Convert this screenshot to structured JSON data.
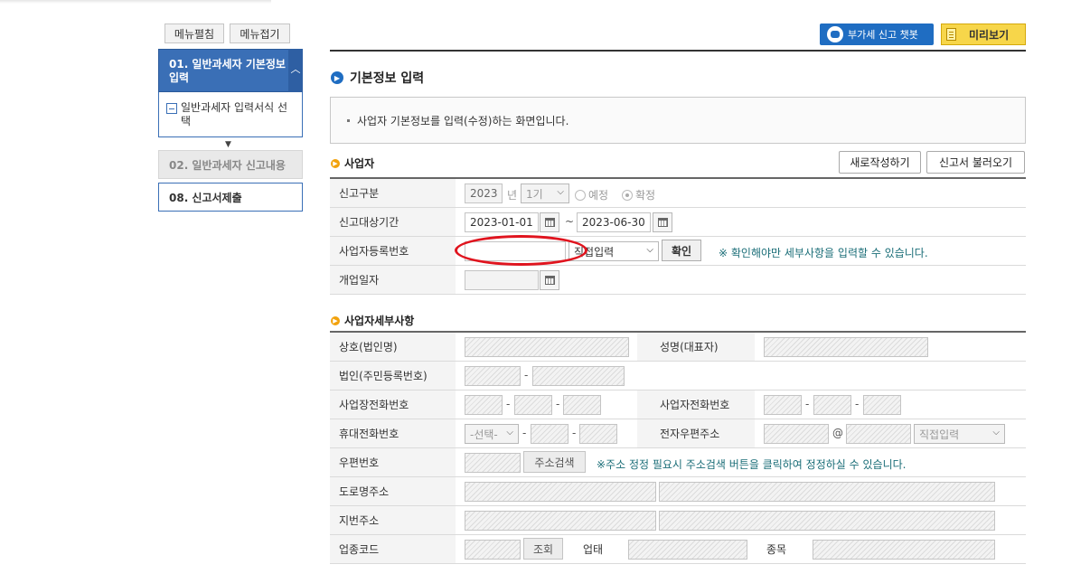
{
  "sidebar": {
    "expand_label": "메뉴펼침",
    "collapse_label": "메뉴접기",
    "active_item": "01. 일반과세자 기본정보 입력",
    "sub_item": "일반과세자 입력서식 선택",
    "item2": "02. 일반과세자 신고내용",
    "item3": "08. 신고서제출"
  },
  "top": {
    "chatbot_label": "부가세 신고 챗봇",
    "preview_label": "미리보기"
  },
  "page": {
    "title": "기본정보 입력",
    "info": "사업자 기본정보를 입력(수정)하는 화면입니다."
  },
  "business": {
    "section_title": "사업자",
    "new_button": "새로작성하기",
    "load_button": "신고서 불러오기",
    "report_type_label": "신고구분",
    "year_value": "2023",
    "year_unit": "년",
    "period_value": "1기",
    "radio_planned": "예정",
    "radio_confirmed": "확정",
    "period_label": "신고대상기간",
    "period_start": "2023-01-01",
    "period_sep": "~",
    "period_end": "2023-06-30",
    "reg_no_label": "사업자등록번호",
    "reg_no_value": "",
    "reg_no_mode": "직접입력",
    "confirm_button": "확인",
    "confirm_note": "※ 확인해야만 세부사항을 입력할 수 있습니다.",
    "open_date_label": "개업일자",
    "open_date_value": ""
  },
  "details": {
    "section_title": "사업자세부사항",
    "company_label": "상호(법인명)",
    "ceo_label": "성명(대표자)",
    "corp_id_label": "법인(주민등록번호)",
    "dash": "-",
    "office_phone_label": "사업장전화번호",
    "owner_phone_label": "사업자전화번호",
    "mobile_label": "휴대전화번호",
    "mobile_select": "-선택-",
    "email_label": "전자우편주소",
    "at": "@",
    "email_domain_select": "직접입력",
    "zip_label": "우편번호",
    "address_search_button": "주소검색",
    "address_note": "※주소 정정 필요시 주소검색 버튼을 클릭하여 정정하실 수 있습니다.",
    "road_address_label": "도로명주소",
    "lot_address_label": "지번주소",
    "industry_code_label": "업종코드",
    "lookup_button": "조회",
    "business_type_label": "업태",
    "item_label": "종목"
  }
}
